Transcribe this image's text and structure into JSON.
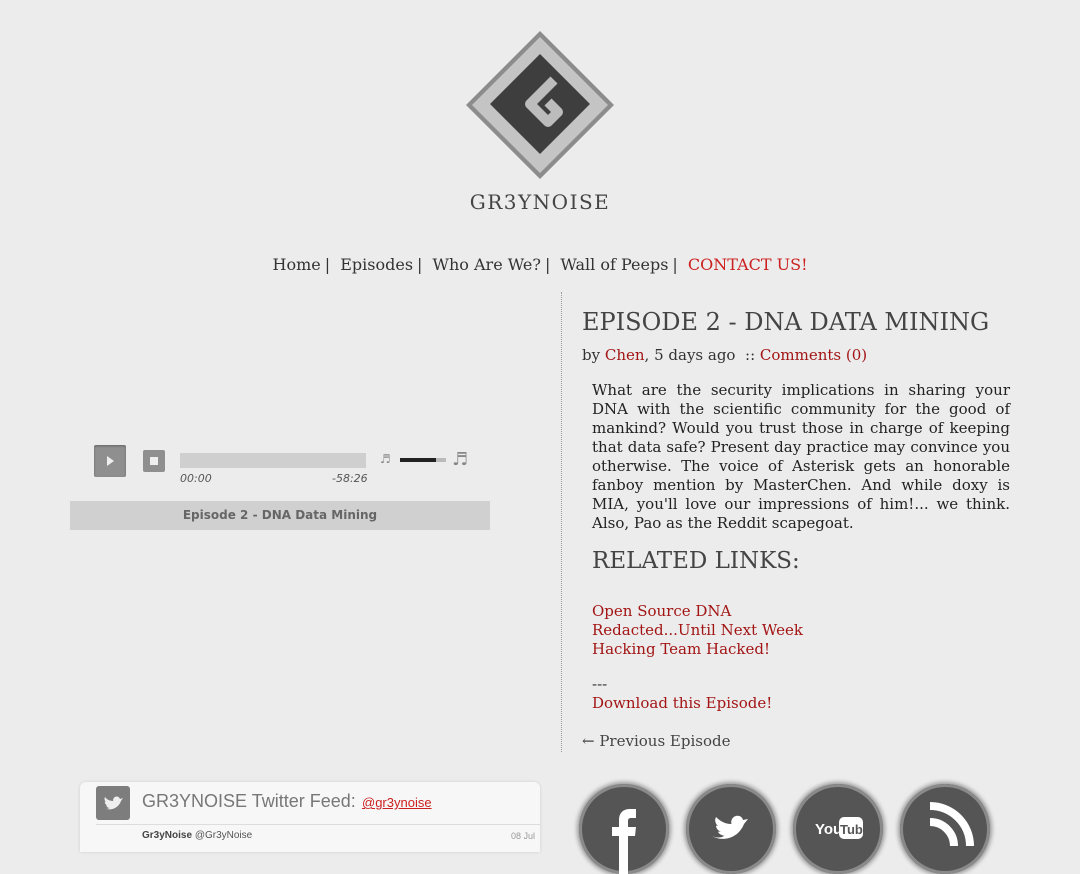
{
  "site": {
    "title": "GR3YNOISE",
    "logo_icon": "gr3ynoise-logo-icon"
  },
  "nav": {
    "items": [
      "Home",
      "Episodes",
      "Who Are We?",
      "Wall of Peeps",
      "CONTACT US!"
    ],
    "separator": "|"
  },
  "player": {
    "current_time": "00:00",
    "remaining_time": "-58:26",
    "progress": 0,
    "volume": 0.78,
    "track_title": "Episode 2 - DNA Data Mining",
    "note_glyph": "♬"
  },
  "episode": {
    "title": "EPISODE 2 - DNA DATA MINING",
    "by_label": "by",
    "author": "Chen",
    "age": ", 5 days ago",
    "sep": "::",
    "comments": "Comments (0)",
    "description": "What are the security implications in sharing your DNA with the scientific community for the good of mankind? Would you trust those in charge of keeping that data safe? Present day practice may convince you otherwise. The voice of Asterisk gets an honorable fanboy mention by MasterChen. And while doxy is MIA, you'll love our impressions of him!... we think. Also, Pao as the Reddit scapegoat.",
    "related_heading": "RELATED LINKS:",
    "related_links": [
      "Open Source DNA",
      "Redacted...Until Next Week",
      "Hacking Team Hacked!"
    ],
    "dashes": "---",
    "download": "Download this Episode!",
    "previous": "← Previous Episode"
  },
  "twitter": {
    "title": "GR3YNOISE Twitter Feed:",
    "handle": "@gr3ynoise",
    "tweet_name": "Gr3yNoise",
    "tweet_handle": "@Gr3yNoise",
    "tweet_date": "08 Jul"
  },
  "social": [
    "facebook-icon",
    "twitter-icon",
    "youtube-icon",
    "rss-icon"
  ],
  "colors": {
    "link_red": "#a31515",
    "contact_red": "#cc1f1f",
    "background": "#ececec"
  }
}
